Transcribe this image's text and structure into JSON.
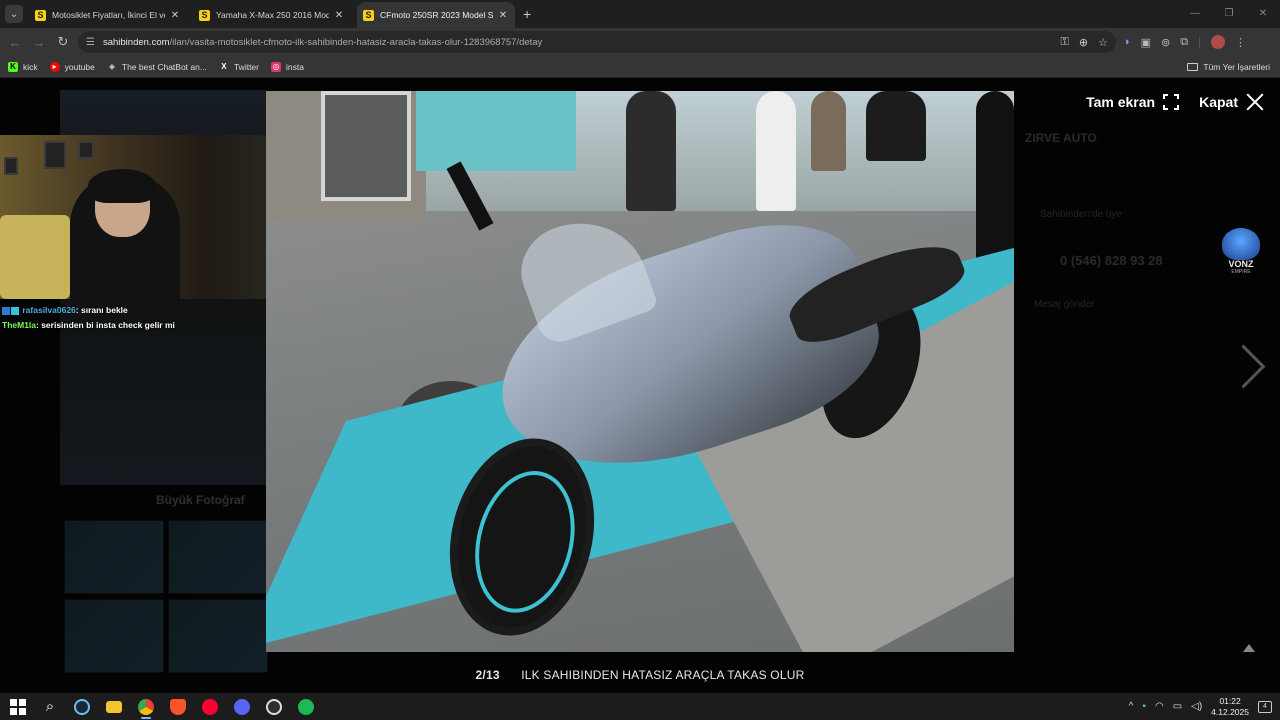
{
  "browser": {
    "tabs": [
      {
        "title": "Motosiklet Fiyatları, İkinci El ve",
        "active": false
      },
      {
        "title": "Yamaha X-Max 250 2016 Mode",
        "active": false
      },
      {
        "title": "CFmoto 250SR 2023 Model Su",
        "active": true
      }
    ],
    "url_host": "sahibinden.com",
    "url_path": "/ilan/vasita-motosiklet-cfmoto-ilk-sahibinden-hatasiz-aracla-takas-olur-1283968757/detay",
    "bookmarks": [
      {
        "label": "kick",
        "icon": "kick-icon",
        "color": "#53fc18"
      },
      {
        "label": "youtube",
        "icon": "youtube-icon",
        "color": "#ff0000"
      },
      {
        "label": "The best ChatBot an...",
        "icon": "chatbot-icon",
        "color": "#dddddd"
      },
      {
        "label": "Twitter",
        "icon": "x-icon",
        "color": "#ffffff"
      },
      {
        "label": "insta",
        "icon": "instagram-icon",
        "color": "#e1306c"
      }
    ],
    "all_bookmarks": "Tüm Yer İşaretleri"
  },
  "page": {
    "big_photo_label": "Büyük Fotoğraf",
    "seller_name": "ZIRVE AUTO",
    "seller_since": "Sahibinden'de üye",
    "phone": "0 (546) 828 93 28",
    "message_link": "Mesaj gönder"
  },
  "chat": [
    {
      "user": "rafasilva0626",
      "message": ": sıranı bekle"
    },
    {
      "user": "TheM1la",
      "message": ": serisinden bi insta check gelir mi"
    }
  ],
  "lightbox": {
    "fullscreen_label": "Tam ekran",
    "close_label": "Kapat",
    "counter": "2/13",
    "caption": "ILK SAHIBINDEN HATASIZ ARAÇLA TAKAS OLUR"
  },
  "watermark": {
    "text": "VONZ",
    "subtext": "EMPIRE"
  },
  "taskbar": {
    "apps": [
      "windows-start-icon",
      "search-icon",
      "steam-icon",
      "file-explorer-icon",
      "chrome-icon",
      "brave-icon",
      "youtube-music-icon",
      "discord-icon",
      "obs-icon",
      "spotify-icon"
    ],
    "time": "01:22",
    "date": "4.12.2025",
    "notifications": "4"
  }
}
